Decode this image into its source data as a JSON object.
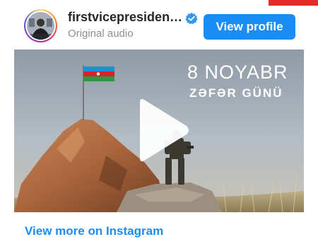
{
  "post": {
    "username": "firstvicepresiden…",
    "audio_label": "Original audio",
    "view_profile_label": "View profile",
    "view_more_label": "View more on Instagram"
  },
  "media": {
    "title": "8 NOYABR",
    "subtitle": "ZƏFƏR GÜNÜ"
  },
  "icons": {
    "verified": "verified-badge-icon",
    "play": "play-icon"
  },
  "colors": {
    "accent": "#1a8cf5",
    "username": "#262626",
    "secondary_text": "#8e8e8e",
    "top_accent": "#e32b2b"
  }
}
